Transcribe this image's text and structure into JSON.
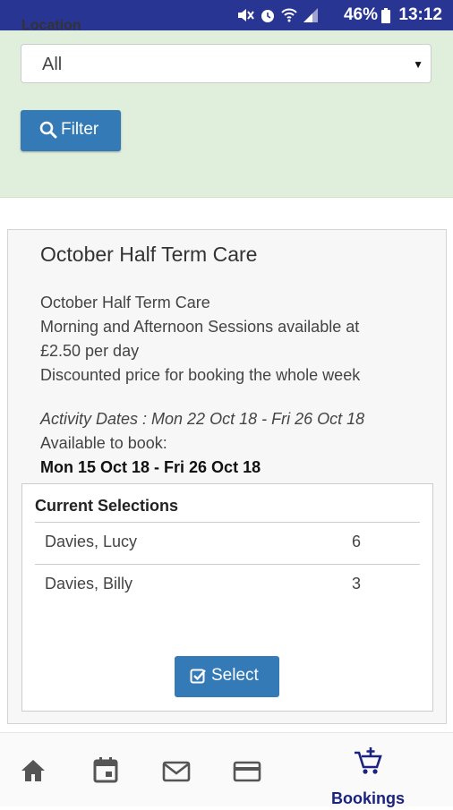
{
  "status_bar": {
    "battery": "46%",
    "time": "13:12",
    "icons": [
      "mute-icon",
      "alarm-icon",
      "wifi-icon",
      "signal-icon",
      "battery-icon"
    ]
  },
  "filter": {
    "location_label": "Location",
    "location_value": "All",
    "filter_button": "Filter"
  },
  "card": {
    "title": "October Half Term Care",
    "description": [
      "October Half Term Care",
      "Morning and Afternoon Sessions available at",
      "£2.50 per day",
      "Discounted price for booking the whole week"
    ],
    "activity_dates": "Activity Dates : Mon 22 Oct 18 - Fri 26 Oct 18",
    "available_label": "Available to book:",
    "available_range": "Mon 15 Oct 18 - Fri 26 Oct 18",
    "selections_title": "Current Selections",
    "selections": [
      {
        "name": "Davies, Lucy",
        "count": "6"
      },
      {
        "name": "Davies, Billy",
        "count": "3"
      }
    ],
    "select_button": "Select"
  },
  "bottom_nav": {
    "items": [
      {
        "icon": "home-icon"
      },
      {
        "icon": "calendar-icon"
      },
      {
        "icon": "mail-icon"
      },
      {
        "icon": "credit-card-icon"
      },
      {
        "icon": "cart-add-icon",
        "label": "Bookings"
      }
    ],
    "active_color": "#1a237e"
  },
  "colors": {
    "status_bar": "#283593",
    "filter_panel": "#e0efdc",
    "primary_button": "#337ab7"
  }
}
